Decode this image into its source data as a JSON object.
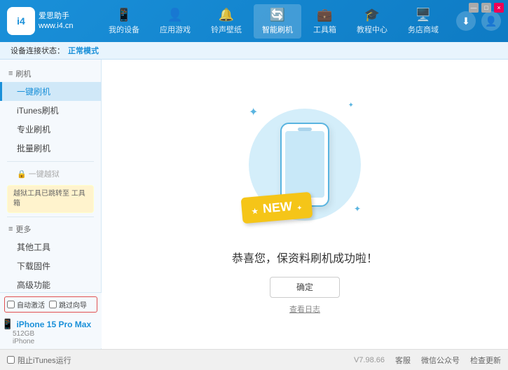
{
  "app": {
    "logo_line1": "爱思助手",
    "logo_line2": "www.i4.cn",
    "logo_abbr": "i4"
  },
  "nav": {
    "tabs": [
      {
        "id": "my-device",
        "icon": "📱",
        "label": "我的设备"
      },
      {
        "id": "app-games",
        "icon": "👤",
        "label": "应用游戏"
      },
      {
        "id": "ringtones",
        "icon": "🔔",
        "label": "铃声壁纸"
      },
      {
        "id": "smart-flash",
        "icon": "🔄",
        "label": "智能刷机",
        "active": true
      },
      {
        "id": "toolbox",
        "icon": "💼",
        "label": "工具箱"
      },
      {
        "id": "tutorial",
        "icon": "🎓",
        "label": "教程中心"
      },
      {
        "id": "service",
        "icon": "🖥️",
        "label": "务店商域"
      }
    ]
  },
  "header_actions": {
    "download_label": "⬇",
    "user_label": "👤"
  },
  "status_bar": {
    "prefix": "设备连接状态：",
    "mode_label": "正常模式"
  },
  "sidebar": {
    "section_flash": "刷机",
    "items": [
      {
        "id": "one-key-flash",
        "label": "一键刷机",
        "active": true
      },
      {
        "id": "itunes-flash",
        "label": "iTunes刷机",
        "active": false
      },
      {
        "id": "pro-flash",
        "label": "专业刷机",
        "active": false
      },
      {
        "id": "batch-flash",
        "label": "批量刷机",
        "active": false
      }
    ],
    "section_jailbreak": "一键越狱",
    "jailbreak_disabled_label": "一键越狱",
    "jailbreak_notice": "越狱工具已跳转至\n工具箱",
    "section_more": "更多",
    "more_items": [
      {
        "id": "other-tools",
        "label": "其他工具"
      },
      {
        "id": "download-firmware",
        "label": "下载固件"
      },
      {
        "id": "advanced",
        "label": "高级功能"
      }
    ]
  },
  "content": {
    "new_badge": "NEW",
    "success_message": "恭喜您，保资料刷机成功啦！",
    "confirm_button": "确定",
    "log_link": "查看日志"
  },
  "device": {
    "auto_activate_label": "自动激活",
    "time_guide_label": "跳过向导",
    "phone_icon": "📱",
    "name": "iPhone 15 Pro Max",
    "storage": "512GB",
    "type": "iPhone"
  },
  "footer": {
    "itunes_checkbox": "阻止iTunes运行",
    "version": "V7.98.66",
    "links": [
      "客服",
      "微信公众号",
      "检查更新"
    ]
  },
  "window_controls": {
    "minimize": "—",
    "maximize": "□",
    "close": "×"
  }
}
